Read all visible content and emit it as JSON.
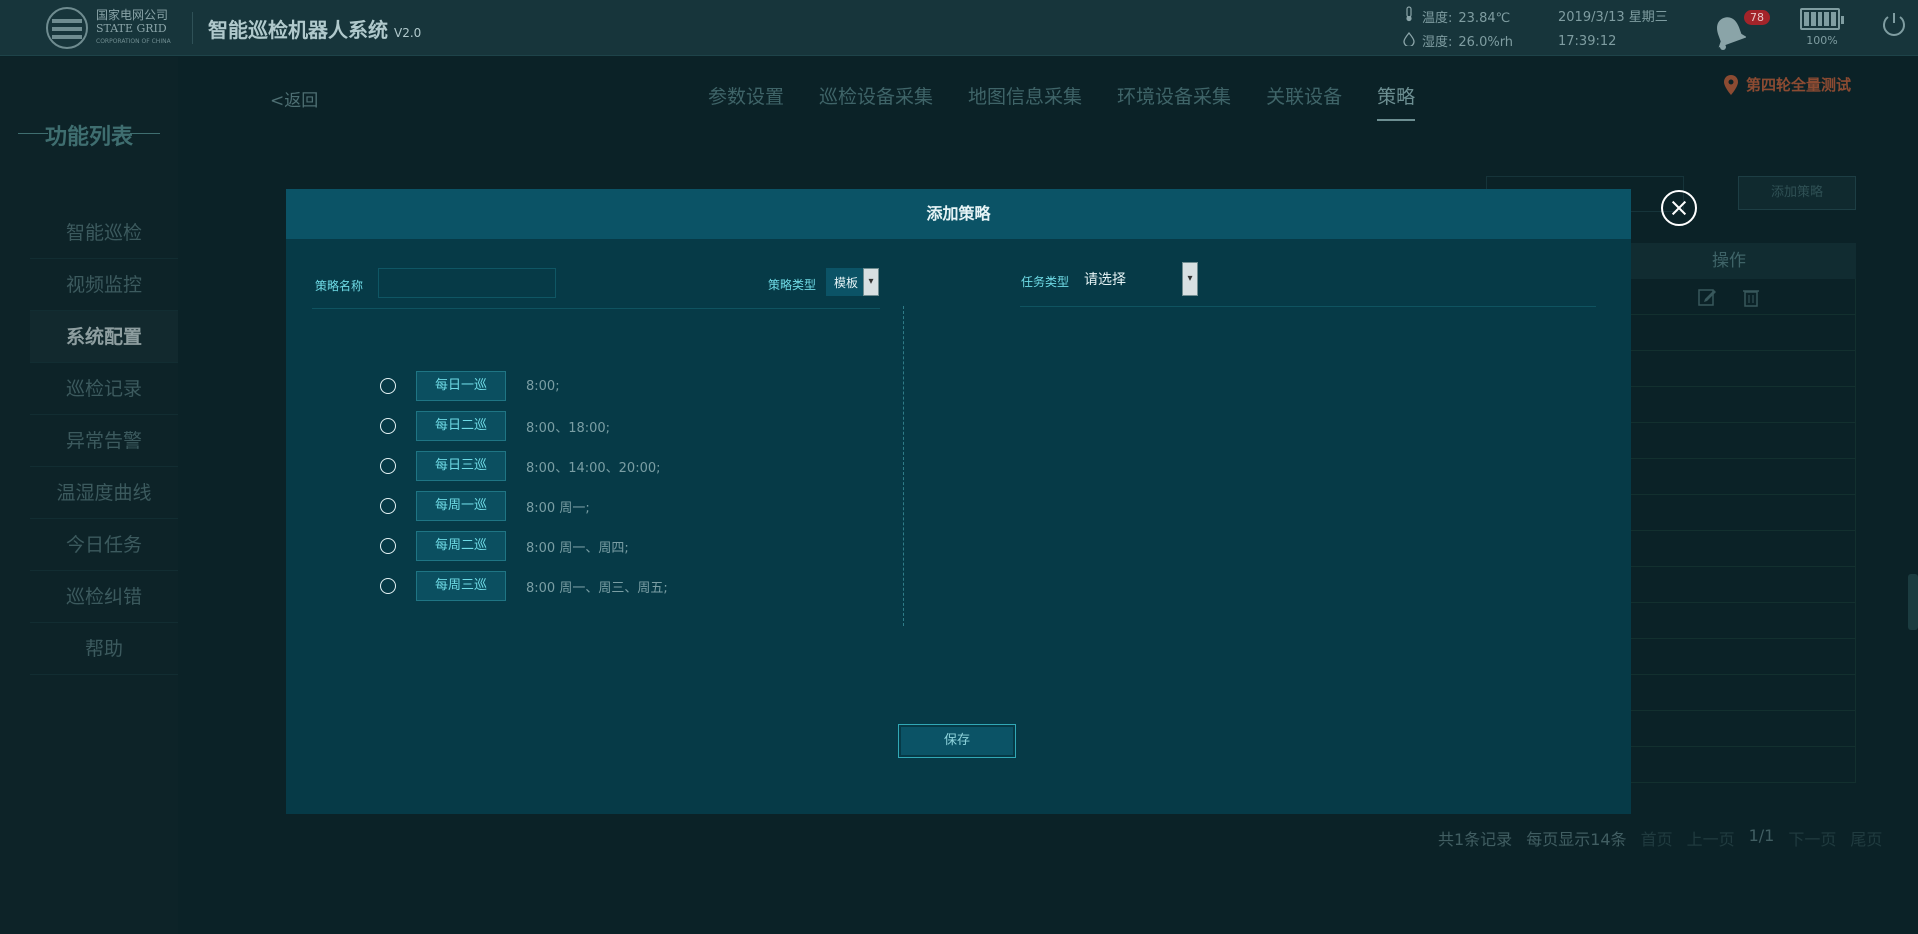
{
  "header": {
    "logo": {
      "cn": "国家电网公司",
      "en": "STATE GRID",
      "sub": "CORPORATION OF CHINA"
    },
    "title": "智能巡检机器人系统",
    "version": "V2.0",
    "temperature": {
      "label": "温度:",
      "value": "23.84℃"
    },
    "humidity": {
      "label": "湿度:",
      "value": "26.0%rh"
    },
    "date": "2019/3/13 星期三",
    "time": "17:39:12",
    "alarm_count": "78",
    "battery_pct": "100%",
    "battery_level": 1.0
  },
  "sidebar": {
    "title": "功能列表",
    "items": [
      {
        "label": "智能巡检"
      },
      {
        "label": "视频监控"
      },
      {
        "label": "系统配置"
      },
      {
        "label": "巡检记录"
      },
      {
        "label": "异常告警"
      },
      {
        "label": "温湿度曲线"
      },
      {
        "label": "今日任务"
      },
      {
        "label": "巡检纠错"
      },
      {
        "label": "帮助"
      }
    ],
    "active": "系统配置"
  },
  "main": {
    "back": "<返回",
    "tabs": [
      {
        "label": "参数设置"
      },
      {
        "label": "巡检设备采集"
      },
      {
        "label": "地图信息采集"
      },
      {
        "label": "环境设备采集"
      },
      {
        "label": "关联设备"
      },
      {
        "label": "策略"
      }
    ],
    "active_tab": "策略",
    "location": "第四轮全量测试",
    "add_button": "添加策略",
    "table_header_action": "操作",
    "pager": {
      "total": "共1条记录",
      "per_page": "每页显示14条",
      "first": "首页",
      "prev": "上一页",
      "page": "1/1",
      "next": "下一页",
      "last": "尾页"
    }
  },
  "modal": {
    "title": "添加策略",
    "name_label": "策略名称",
    "name_value": "",
    "type_label": "策略类型",
    "type_value": "模板",
    "task_type_label": "任务类型",
    "task_type_value": "请选择",
    "options": [
      {
        "label": "每日一巡",
        "time": "8:00;"
      },
      {
        "label": "每日二巡",
        "time": "8:00、18:00;"
      },
      {
        "label": "每日三巡",
        "time": "8:00、14:00、20:00;"
      },
      {
        "label": "每周一巡",
        "time": "8:00  周一;"
      },
      {
        "label": "每周二巡",
        "time": "8:00  周一、周四;"
      },
      {
        "label": "每周三巡",
        "time": "8:00  周一、周三、周五;"
      }
    ],
    "save": "保存"
  },
  "colors": {
    "modal_bg": "#063a47",
    "modal_header": "#0b5366",
    "label_cyan": "#6fdbe6",
    "location_orange": "#8c4b32",
    "badge_red": "#a3242a"
  }
}
